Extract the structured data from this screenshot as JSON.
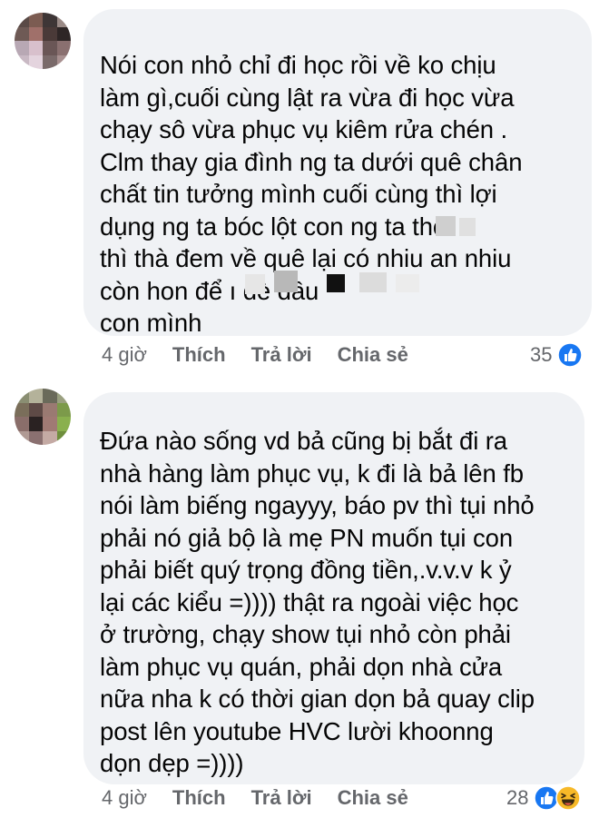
{
  "comments": [
    {
      "text": "Nói con nhỏ chỉ đi học rồi về ko chịu\nlàm gì,cuối cùng lật ra vừa đi học vừa\nchạy sô vừa phục vụ kiêm rửa chén .\nClm thay gia đình ng ta dưới quê chân\nchất tin tưởng mình cuối cùng thì lợi\ndụng ng ta bóc lột con ng ta        thoi\nthì thà đem về quê lại có nhiu an nhiu\ncòn hon để                                 ı đè đầu\ncon mình",
      "time": "4 giờ",
      "like_label": "Thích",
      "reply_label": "Trả lời",
      "share_label": "Chia sẻ",
      "reaction_count": "35",
      "reactions": [
        "like-icon"
      ]
    },
    {
      "text": "Đứa nào sống vd bả cũng bị bắt đi ra\nnhà hàng làm phục vụ, k đi là bả lên fb\nnói làm biếng ngayyy, báo pv thì tụi nhỏ\nphải nó giả bộ là mẹ PN muốn tụi con\nphải biết quý trọng đồng tiền,.v.v.v k ỷ\nlại các kiểu =)))) thật ra ngoài việc học\nở trường, chạy show tụi nhỏ còn phải\nlàm phục vụ quán, phải dọn nhà cửa\nnữa nha k có thời gian dọn bả quay clip\npost lên youtube HVC lười khoonng\ndọn dẹp =))))",
      "time": "4 giờ",
      "like_label": "Thích",
      "reply_label": "Trả lời",
      "share_label": "Chia sẻ",
      "reaction_count": "28",
      "reactions": [
        "like-icon",
        "haha-icon"
      ]
    }
  ],
  "colors": {
    "bubble": "#f0f2f5",
    "text": "#050505",
    "meta": "#65676b",
    "like_blue": "#1877f2",
    "haha_yellow": "#f7b928"
  }
}
